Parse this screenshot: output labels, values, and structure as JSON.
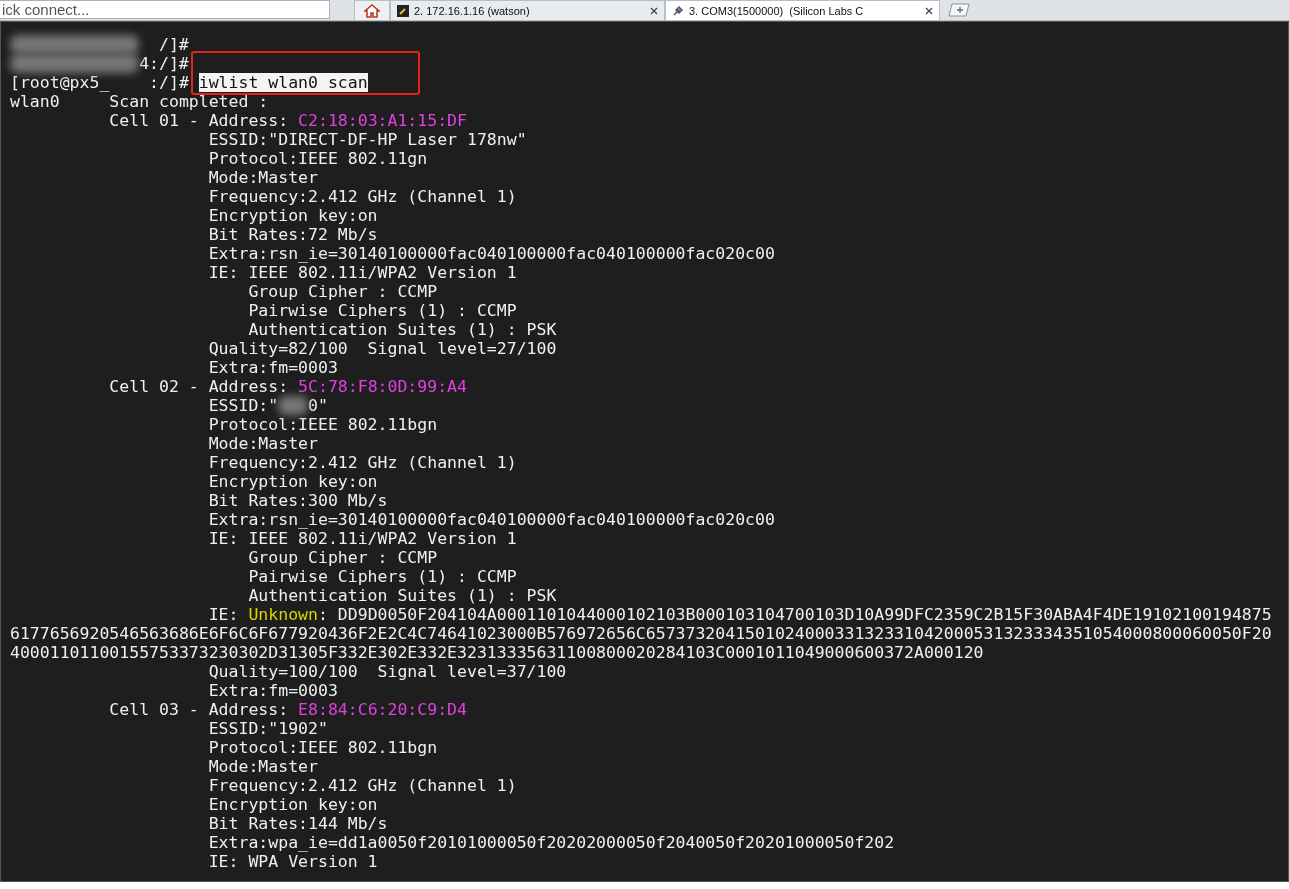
{
  "toolbar": {
    "quick_connect": {
      "placeholder": "ick connect..."
    }
  },
  "tabs": [
    {
      "kind": "home",
      "selected": false
    },
    {
      "kind": "session",
      "label": "2. 172.16.1.16 (watson)",
      "selected": false
    },
    {
      "kind": "session",
      "label": "3. COM3(1500000)  (Silicon Labs C",
      "selected": true
    },
    {
      "kind": "new"
    }
  ],
  "terminal": {
    "lines": [
      {
        "segments": [
          {
            "kind": "redacted_wide"
          },
          {
            "kind": "text",
            "text": "  /]#"
          }
        ]
      },
      {
        "segments": [
          {
            "kind": "redacted_wide"
          },
          {
            "kind": "text",
            "text": "4:/]#"
          }
        ]
      },
      {
        "segments": [
          {
            "kind": "text",
            "text": "[root@px5_    :/]# "
          },
          {
            "kind": "command",
            "text": "iwlist wlan0 scan",
            "boxed": true
          }
        ]
      },
      {
        "segments": [
          {
            "kind": "text",
            "text": "wlan0     Scan completed :"
          }
        ]
      },
      {
        "segments": [
          {
            "kind": "text",
            "text": "          Cell 01 - Address: "
          },
          {
            "kind": "address",
            "text": "C2:18:03:A1:15:DF"
          }
        ]
      },
      {
        "segments": [
          {
            "kind": "text",
            "text": "                    ESSID:\"DIRECT-DF-HP Laser 178nw\""
          }
        ]
      },
      {
        "segments": [
          {
            "kind": "text",
            "text": "                    Protocol:IEEE 802.11gn"
          }
        ]
      },
      {
        "segments": [
          {
            "kind": "text",
            "text": "                    Mode:Master"
          }
        ]
      },
      {
        "segments": [
          {
            "kind": "text",
            "text": "                    Frequency:2.412 GHz (Channel 1)"
          }
        ]
      },
      {
        "segments": [
          {
            "kind": "text",
            "text": "                    Encryption key:on"
          }
        ]
      },
      {
        "segments": [
          {
            "kind": "text",
            "text": "                    Bit Rates:72 Mb/s"
          }
        ]
      },
      {
        "segments": [
          {
            "kind": "text",
            "text": "                    Extra:rsn_ie=30140100000fac040100000fac040100000fac020c00"
          }
        ]
      },
      {
        "segments": [
          {
            "kind": "text",
            "text": "                    IE: IEEE 802.11i/WPA2 Version 1"
          }
        ]
      },
      {
        "segments": [
          {
            "kind": "text",
            "text": "                        Group Cipher : CCMP"
          }
        ]
      },
      {
        "segments": [
          {
            "kind": "text",
            "text": "                        Pairwise Ciphers (1) : CCMP"
          }
        ]
      },
      {
        "segments": [
          {
            "kind": "text",
            "text": "                        Authentication Suites (1) : PSK"
          }
        ]
      },
      {
        "segments": [
          {
            "kind": "text",
            "text": "                    Quality=82/100  Signal level=27/100"
          }
        ]
      },
      {
        "segments": [
          {
            "kind": "text",
            "text": "                    Extra:fm=0003"
          }
        ]
      },
      {
        "segments": [
          {
            "kind": "text",
            "text": "          Cell 02 - Address: "
          },
          {
            "kind": "address",
            "text": "5C:78:F8:0D:99:A4"
          }
        ]
      },
      {
        "segments": [
          {
            "kind": "text",
            "text": "                    ESSID:\""
          },
          {
            "kind": "redacted"
          },
          {
            "kind": "text",
            "text": "0\""
          }
        ]
      },
      {
        "segments": [
          {
            "kind": "text",
            "text": "                    Protocol:IEEE 802.11bgn"
          }
        ]
      },
      {
        "segments": [
          {
            "kind": "text",
            "text": "                    Mode:Master"
          }
        ]
      },
      {
        "segments": [
          {
            "kind": "text",
            "text": "                    Frequency:2.412 GHz (Channel 1)"
          }
        ]
      },
      {
        "segments": [
          {
            "kind": "text",
            "text": "                    Encryption key:on"
          }
        ]
      },
      {
        "segments": [
          {
            "kind": "text",
            "text": "                    Bit Rates:300 Mb/s"
          }
        ]
      },
      {
        "segments": [
          {
            "kind": "text",
            "text": "                    Extra:rsn_ie=30140100000fac040100000fac040100000fac020c00"
          }
        ]
      },
      {
        "segments": [
          {
            "kind": "text",
            "text": "                    IE: IEEE 802.11i/WPA2 Version 1"
          }
        ]
      },
      {
        "segments": [
          {
            "kind": "text",
            "text": "                        Group Cipher : CCMP"
          }
        ]
      },
      {
        "segments": [
          {
            "kind": "text",
            "text": "                        Pairwise Ciphers (1) : CCMP"
          }
        ]
      },
      {
        "segments": [
          {
            "kind": "text",
            "text": "                        Authentication Suites (1) : PSK"
          }
        ]
      },
      {
        "segments": [
          {
            "kind": "text",
            "text": "                    IE: "
          },
          {
            "kind": "unknown",
            "text": "Unknown"
          },
          {
            "kind": "text",
            "text": ": DD9D0050F204104A0001101044000102103B000103104700103D10A99DFC2359C2B15F30ABA4F4DE19102100194875"
          }
        ]
      },
      {
        "segments": [
          {
            "kind": "text",
            "text": "6177656920546563686E6F6C6F677920436F2E2C4C74641023000B576972656C657373204150102400033132331042000531323334351054000800060050F20"
          }
        ]
      },
      {
        "segments": [
          {
            "kind": "text",
            "text": "40001101100155753373230302D31305F332E302E332E32313335631100800020284103C0001011049000600372A000120"
          }
        ]
      },
      {
        "segments": [
          {
            "kind": "text",
            "text": "                    Quality=100/100  Signal level=37/100"
          }
        ]
      },
      {
        "segments": [
          {
            "kind": "text",
            "text": "                    Extra:fm=0003"
          }
        ]
      },
      {
        "segments": [
          {
            "kind": "text",
            "text": "          Cell 03 - Address: "
          },
          {
            "kind": "address",
            "text": "E8:84:C6:20:C9:D4"
          }
        ]
      },
      {
        "segments": [
          {
            "kind": "text",
            "text": "                    ESSID:\"1902\""
          }
        ]
      },
      {
        "segments": [
          {
            "kind": "text",
            "text": "                    Protocol:IEEE 802.11bgn"
          }
        ]
      },
      {
        "segments": [
          {
            "kind": "text",
            "text": "                    Mode:Master"
          }
        ]
      },
      {
        "segments": [
          {
            "kind": "text",
            "text": "                    Frequency:2.412 GHz (Channel 1)"
          }
        ]
      },
      {
        "segments": [
          {
            "kind": "text",
            "text": "                    Encryption key:on"
          }
        ]
      },
      {
        "segments": [
          {
            "kind": "text",
            "text": "                    Bit Rates:144 Mb/s"
          }
        ]
      },
      {
        "segments": [
          {
            "kind": "text",
            "text": "                    Extra:wpa_ie=dd1a0050f20101000050f20202000050f2040050f20201000050f202"
          }
        ]
      },
      {
        "segments": [
          {
            "kind": "text",
            "text": "                    IE: WPA Version 1"
          }
        ]
      }
    ]
  }
}
